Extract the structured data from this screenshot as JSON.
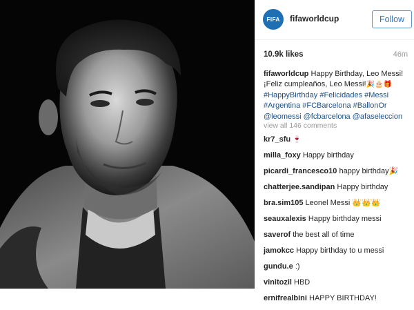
{
  "post": {
    "image_alt": "Black and white portrait photo",
    "account": {
      "avatar_text": "FIFA",
      "username": "fifaworldcup",
      "follow_label": "Follow"
    },
    "likes": "10.9k likes",
    "timestamp": "46m",
    "caption": {
      "user": "fifaworldcup",
      "line1": "Happy Birthday, Leo Messi!",
      "line2": "¡Feliz cumpleaños, Leo Messi!",
      "line2_emoji": "🎉🎂🎁",
      "hashtags": [
        "#HappyBirthday",
        "#Felicidades",
        "#Messi",
        "#Argentina",
        "#FCBarcelona",
        "#BallonOr"
      ],
      "mentions": [
        "@leomessi",
        "@fcbarcelona",
        "@afaseleccion"
      ]
    },
    "view_all_comments": "view all 146 comments",
    "comments": [
      {
        "user": "kr7_sfu",
        "text": "🍷"
      },
      {
        "user": "milla_foxy",
        "text": "Happy birthday"
      },
      {
        "user": "picardi_francesco10",
        "text": "happy birthday🎉"
      },
      {
        "user": "chatterjee.sandipan",
        "text": "Happy birthday"
      },
      {
        "user": "bra.sim105",
        "text": "Leonel Messi 👑👑👑"
      },
      {
        "user": "seauxalexis",
        "text": "Happy birthday messi"
      },
      {
        "user": "saverof",
        "text": "the best all of time"
      },
      {
        "user": "jamokcc",
        "text": "Happy birthday to u messi"
      },
      {
        "user": "gundu.e",
        "text": ":)"
      },
      {
        "user": "vinitozil",
        "text": "HBD"
      },
      {
        "user": "ernifrealbini",
        "text": "HAPPY BIRTHDAY!"
      }
    ],
    "colors": {
      "link": "#1a4f8a",
      "follow": "#3b73b9",
      "avatar_bg": "#1f6fb5",
      "muted": "#9a9a9a"
    }
  }
}
